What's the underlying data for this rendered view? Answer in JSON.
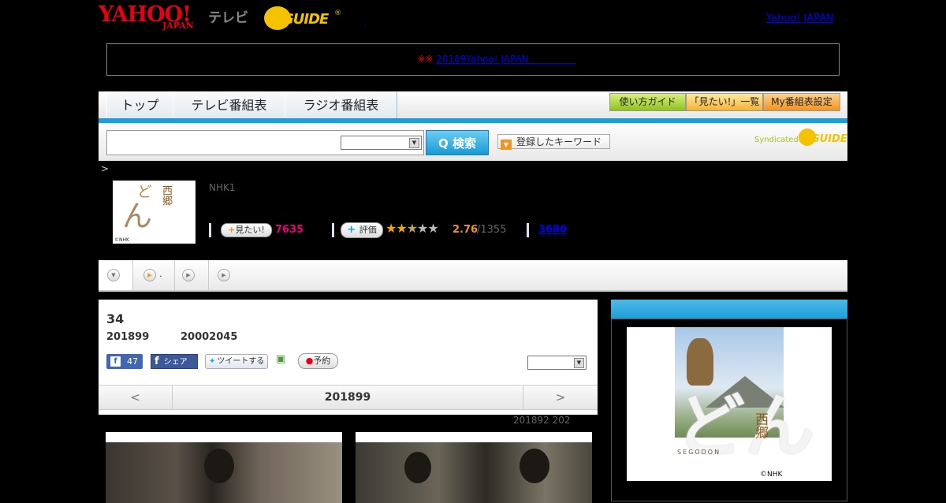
{
  "header": {
    "logo_yahoo": "YAHOO!",
    "logo_japan": "JAPAN",
    "logo_tv": "テレビ",
    "logo_guide": "GUIDE",
    "logo_reg": "®",
    "dot_link": ".",
    "yahoo_japan_link": "Yahoo! JAPAN",
    "yahoo_japan_dot": "."
  },
  "notice": {
    "mark": "※※ ",
    "link": "20189Yahoo! JAPAN　　　　　"
  },
  "nav": {
    "tabs": [
      {
        "label": "トップ"
      },
      {
        "label": "テレビ番組表"
      },
      {
        "label": "ラジオ番組表"
      }
    ],
    "buttons": {
      "guide": "使い方ガイド",
      "mitai_list": "「見たい!」一覧",
      "my_schedule": "My番組表設定"
    }
  },
  "search": {
    "input_value": "",
    "select_value": "",
    "button_label": "Q 検索",
    "keyword_button": "登録したキーワード",
    "syndicated": "Syndicated",
    "syndicated_guide": "GUIDE"
  },
  "breadcrumb": ">",
  "program": {
    "thumb_ki": "ど",
    "thumb_don": "ん",
    "thumb_saigo": "西郷",
    "thumb_credit": "©NHK",
    "channel": "NHK1",
    "mitai_label": "見たい!",
    "mitai_count": "7635",
    "hyoka_label": "評価",
    "stars": "★★★★★",
    "rating_value": 2.76,
    "rating": "2.76",
    "rating_total": "/1355",
    "reviews": "3680"
  },
  "subtabs": [
    {
      "label": ""
    },
    {
      "label": "."
    },
    {
      "label": ""
    },
    {
      "label": ""
    }
  ],
  "episode": {
    "title": "34",
    "date": "201899",
    "time": "20002045",
    "fb_like_count": "47",
    "fb_share": "シェア",
    "tweet": "ツイートする",
    "reserve": "予約",
    "select_value": ""
  },
  "pager": {
    "prev": "<",
    "date": "201899",
    "next": ">"
  },
  "tiny_dates": "201892  202",
  "poster": {
    "don": "どん",
    "saigo": "西郷",
    "segodon": "SEGODON",
    "credit": "©NHK"
  },
  "colors": {
    "accent_blue": "#1a9fd9",
    "yahoo_red": "#e60012",
    "guide_yellow": "#f5c200",
    "mitai_pink": "#e6007e",
    "rating_orange": "#f39320"
  }
}
